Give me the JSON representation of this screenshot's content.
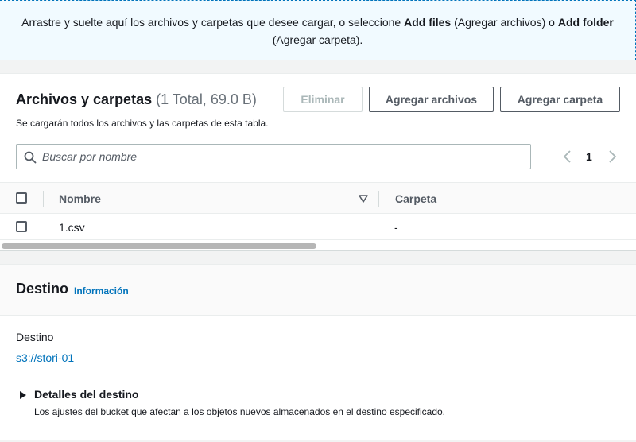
{
  "dropzone": {
    "text_before": "Arrastre y suelte aquí los archivos y carpetas que desee cargar, o seleccione ",
    "add_files_bold": "Add files",
    "add_files_translation": " (Agregar archivos) o ",
    "add_folder_bold": "Add folder",
    "add_folder_translation": " (Agregar carpeta)."
  },
  "files": {
    "title": "Archivos y carpetas",
    "count": "(1 Total, 69.0 B)",
    "description": "Se cargarán todos los archivos y las carpetas de esta tabla.",
    "delete_button": "Eliminar",
    "add_files_button": "Agregar archivos",
    "add_folder_button": "Agregar carpeta",
    "search_placeholder": "Buscar por nombre",
    "search_value": "",
    "page_number": "1",
    "columns": [
      "Nombre",
      "Carpeta"
    ],
    "rows": [
      {
        "name": "1.csv",
        "folder": "-"
      }
    ]
  },
  "destination": {
    "title": "Destino",
    "info_link": "Información",
    "label": "Destino",
    "uri": "s3://stori-01",
    "details_title": "Detalles del destino",
    "details_description": "Los ajustes del bucket que afectan a los objetos nuevos almacenados en el destino especificado."
  },
  "icons": {
    "search": "search-icon",
    "prev": "chevron-left-icon",
    "next": "chevron-right-icon",
    "sort": "sort-down-icon",
    "expand": "caret-right-icon"
  },
  "colors": {
    "link": "#0073bb",
    "dropzone_border": "#0073bb",
    "dropzone_bg": "#f1faff"
  }
}
